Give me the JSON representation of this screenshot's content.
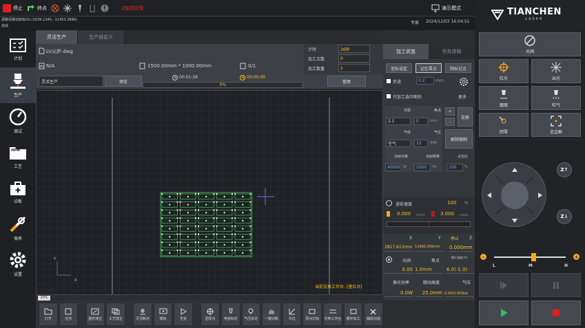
{
  "topbar": {
    "stop_label": "停止",
    "endpoint_label": "终点",
    "warning_text": "Z轴错报警",
    "demo_mode_label": "演示模式"
  },
  "infobar": {
    "line1": "源路径移动目标(0):(1639.1340, -11453.3886)",
    "line2": "完成",
    "user": "专家",
    "datetime": "2024/12/03 16:04:51"
  },
  "nav": {
    "items": [
      {
        "label": "计划"
      },
      {
        "label": "生产"
      },
      {
        "label": "调试"
      },
      {
        "label": "工艺",
        "badge": "HPM"
      },
      {
        "label": "诊断"
      },
      {
        "label": "保养"
      },
      {
        "label": "设置"
      }
    ]
  },
  "tabs": {
    "production": "灵活生产",
    "custom": "生产自定义"
  },
  "file": {
    "name": "LV火炉.dwg",
    "na": "N/A",
    "size": "1500.00mm * 1000.00mm",
    "count": "0/1",
    "mode": "灵活生产",
    "preview": "预览",
    "time1": "00:01:28",
    "time2": "00:00:00",
    "progress_text": "0%",
    "progress": 0
  },
  "counters": {
    "timer_label": "计时",
    "timer_value": "26秒",
    "times_label": "加工次数",
    "times_value": "0",
    "qty_label": "加工数量",
    "qty_value": "2",
    "manage": "管理"
  },
  "canvas": {
    "status": "当前交换工作台: [基位台]",
    "zoom": "20%",
    "y_axis": "Y",
    "x_axis": "X"
  },
  "bottom": {
    "buttons": [
      "打开",
      "任务",
      "图形修正",
      "工艺修正",
      "灵活断点",
      "模拟",
      "空走",
      "回零点",
      "电容标定",
      "气压标定",
      "一键切断",
      "寻边",
      "预点打标",
      "交换工作台",
      "循环加工",
      "辅助功能"
    ]
  },
  "proc": {
    "tab_status": "加工状态",
    "tab_tasks": "任务排版",
    "coord_set": "坐标设定",
    "memory": "记忆零点",
    "return_pt": "回标记点",
    "step_label": "步进",
    "step_value": "0.2",
    "step_unit": "mm",
    "only_selected": "只加工选中图形",
    "more": "更多",
    "nozzle_label": "光斑",
    "nozzle_value": "2.1",
    "focus_label": "焦点",
    "focus_value": "0",
    "focus_unit": "mm",
    "swap": "交换",
    "gas_label": "气体",
    "gas_value": "空气",
    "pressure_label": "气压",
    "pressure_value": "12",
    "pressure_unit": "BAR",
    "release": "解除限制",
    "power_label": "点射功率",
    "power_value": "40000",
    "power_unit": "W",
    "freq_label": "点射频率",
    "freq_value": "2000",
    "freq_unit": "Hz",
    "duty_label": "占空比",
    "duty_value": "100",
    "duty_unit": "%",
    "speed_label": "进给速度",
    "speed_value": "100",
    "speed_unit": "%",
    "spd1": "0.000",
    "spd1_unit": "m/min",
    "spd2": "3.000",
    "spd2_unit": "m/min",
    "x_label": "X",
    "x_value": "2817.613mm",
    "y_label": "Y",
    "y_value": "12680.256mm",
    "z_label": "Z",
    "z_state": "停止",
    "z_value": "0.000mm",
    "laser_label": "光阀",
    "focus2_label": "焦点",
    "temp_label": "镜片温度(℃)",
    "laser_val": "0.00",
    "focus2_val": "1.0mm",
    "temp_val": "6.0(-1.0)",
    "lpower_label": "激光功率",
    "height_label": "随动高度",
    "gas2_label": "气压",
    "lpower_val": "0.0W",
    "height_val": "25.0mm",
    "gas2_val": "0.00(0.00)bar"
  },
  "right": {
    "brand": "TIANCHEN",
    "brand_sub": "LASER",
    "shutter": "光阀",
    "red_light": "红光",
    "laser_out": "出光",
    "follow": "跟随",
    "blow": "吹气",
    "return_home": "回零",
    "frame": "走边框",
    "z_up": "Z↑",
    "z_down": "Z↓",
    "slider_low": "L",
    "slider_mid": "M",
    "slider_high": "H",
    "slider_level": 0.55
  },
  "colors": {
    "accent_blue": "#6aa8ff",
    "warn_red": "#e02020",
    "value_yellow": "#f5c518",
    "part_green": "#4cd964",
    "start_green": "#22c55e",
    "stop_red": "#e11d1d"
  }
}
